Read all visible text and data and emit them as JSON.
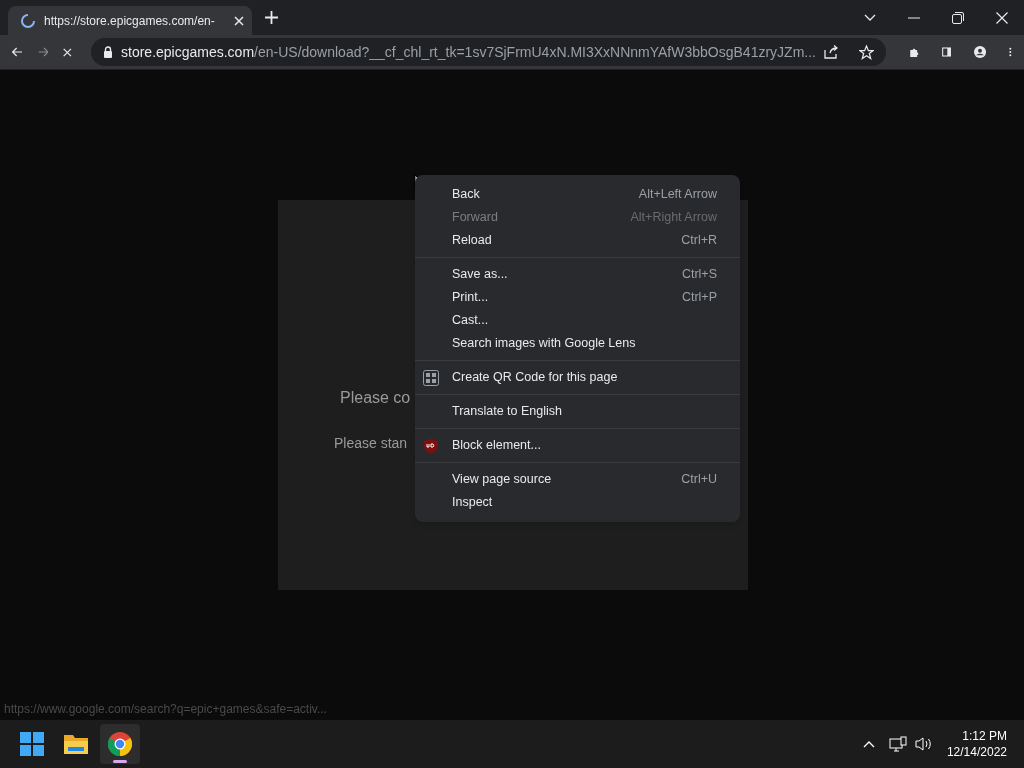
{
  "tab": {
    "title": "https://store.epicgames.com/en-",
    "loading": true
  },
  "address_bar": {
    "domain": "store.epicgames.com",
    "path": "/en-US/download?__cf_chl_rt_tk=1sv7SjFrmU4xN.MI3XxNNnmYAfW3bbOsgB41zryJZm..."
  },
  "page": {
    "heading": "Please co",
    "message": "Please stan"
  },
  "context_menu": {
    "sections": [
      [
        {
          "label": "Back",
          "shortcut": "Alt+Left Arrow",
          "disabled": false
        },
        {
          "label": "Forward",
          "shortcut": "Alt+Right Arrow",
          "disabled": true
        },
        {
          "label": "Reload",
          "shortcut": "Ctrl+R",
          "disabled": false
        }
      ],
      [
        {
          "label": "Save as...",
          "shortcut": "Ctrl+S",
          "disabled": false
        },
        {
          "label": "Print...",
          "shortcut": "Ctrl+P",
          "disabled": false
        },
        {
          "label": "Cast...",
          "disabled": false
        },
        {
          "label": "Search images with Google Lens",
          "disabled": false
        }
      ],
      [
        {
          "label": "Create QR Code for this page",
          "kind": "qr",
          "disabled": false
        }
      ],
      [
        {
          "label": "Translate to English",
          "disabled": false
        }
      ],
      [
        {
          "label": "Block element...",
          "kind": "shield",
          "disabled": false
        }
      ],
      [
        {
          "label": "View page source",
          "shortcut": "Ctrl+U",
          "disabled": false
        },
        {
          "label": "Inspect",
          "disabled": false
        }
      ]
    ]
  },
  "status_link": "https://www.google.com/search?q=epic+games&safe=activ...",
  "taskbar": {
    "apps": [
      {
        "kind": "start",
        "selected": false
      },
      {
        "kind": "files",
        "selected": false
      },
      {
        "kind": "chrome",
        "selected": true
      }
    ],
    "time": "1:12 PM",
    "date": "12/14/2022"
  }
}
